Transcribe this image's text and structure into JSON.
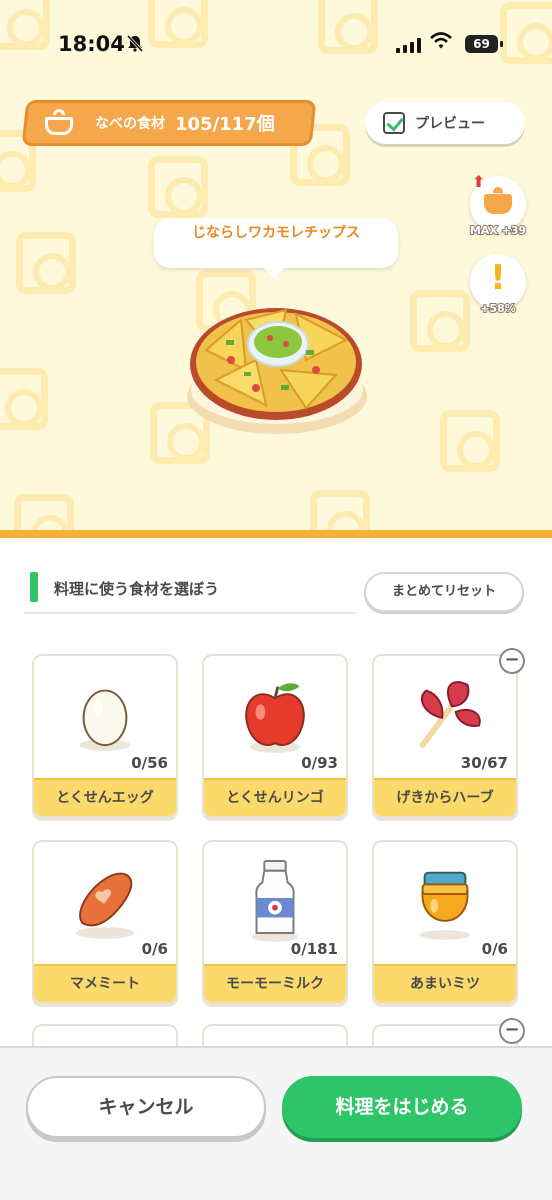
{
  "status_bar": {
    "time": "18:04",
    "battery": "69",
    "bell_icon": "bell-slash-icon",
    "wifi_icon": "wifi-icon"
  },
  "pot": {
    "label": "なべの食材",
    "count": "105/117個",
    "icon": "pot-icon"
  },
  "preview": {
    "label": "プレビュー",
    "checked": true
  },
  "side_buttons": {
    "max_label": "MAX +39",
    "bonus_label": "+58%"
  },
  "dish": {
    "name": "じならしワカモレチップス"
  },
  "section": {
    "title": "料理に使う食材を選ぼう",
    "reset_label": "まとめてリセット"
  },
  "ingredients": [
    {
      "name": "とくせんエッグ",
      "count": "0/56",
      "icon": "egg-icon"
    },
    {
      "name": "とくせんリンゴ",
      "count": "0/93",
      "icon": "apple-icon"
    },
    {
      "name": "げきからハーブ",
      "count": "30/67",
      "icon": "herb-icon"
    },
    {
      "name": "マメミート",
      "count": "0/6",
      "icon": "sausage-icon"
    },
    {
      "name": "モーモーミルク",
      "count": "0/181",
      "icon": "milk-bottle-icon"
    },
    {
      "name": "あまいミツ",
      "count": "0/6",
      "icon": "honey-jar-icon"
    }
  ],
  "actions": {
    "cancel_label": "キャンセル",
    "start_label": "料理をはじめる"
  },
  "colors": {
    "accent_orange": "#f6a64b",
    "ingredient_label_bg": "#fbd96a",
    "start_green": "#2fc46a",
    "dish_name": "#e88a22"
  }
}
